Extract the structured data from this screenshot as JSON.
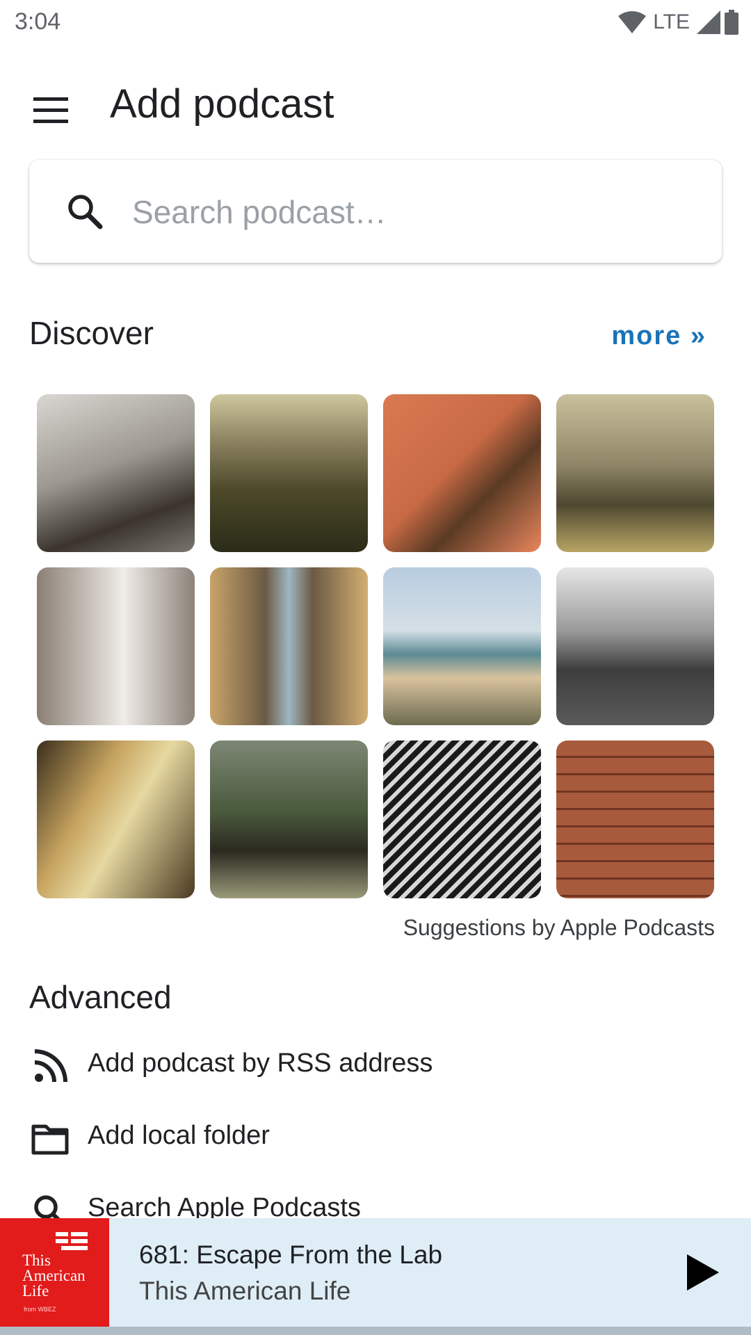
{
  "status": {
    "time": "3:04",
    "network": "LTE",
    "icons": [
      "wifi-icon",
      "signal-icon",
      "battery-icon"
    ]
  },
  "appbar": {
    "title": "Add podcast",
    "menu_icon": "menu-icon"
  },
  "search": {
    "placeholder": "Search podcast…",
    "value": ""
  },
  "discover": {
    "title": "Discover",
    "more_label": "more »",
    "credit": "Suggestions by Apple Podcasts",
    "tiles": [
      "podcast-cover-1",
      "podcast-cover-2",
      "podcast-cover-3",
      "podcast-cover-4",
      "podcast-cover-5",
      "podcast-cover-6",
      "podcast-cover-7",
      "podcast-cover-8",
      "podcast-cover-9",
      "podcast-cover-10",
      "podcast-cover-11",
      "podcast-cover-12"
    ]
  },
  "advanced": {
    "title": "Advanced",
    "items": [
      {
        "label": "Add podcast by RSS address",
        "icon": "rss-icon"
      },
      {
        "label": "Add local folder",
        "icon": "folder-icon"
      },
      {
        "label": "Search Apple Podcasts",
        "icon": "search-icon"
      }
    ]
  },
  "player": {
    "episode": "681: Escape From the Lab",
    "podcast": "This American Life",
    "art_title": "This American Life",
    "art_subtitle": "from WBEZ",
    "accent": "#e21b1b",
    "background": "#deedf6"
  },
  "colors": {
    "link": "#1a73b8",
    "text": "#202124"
  }
}
